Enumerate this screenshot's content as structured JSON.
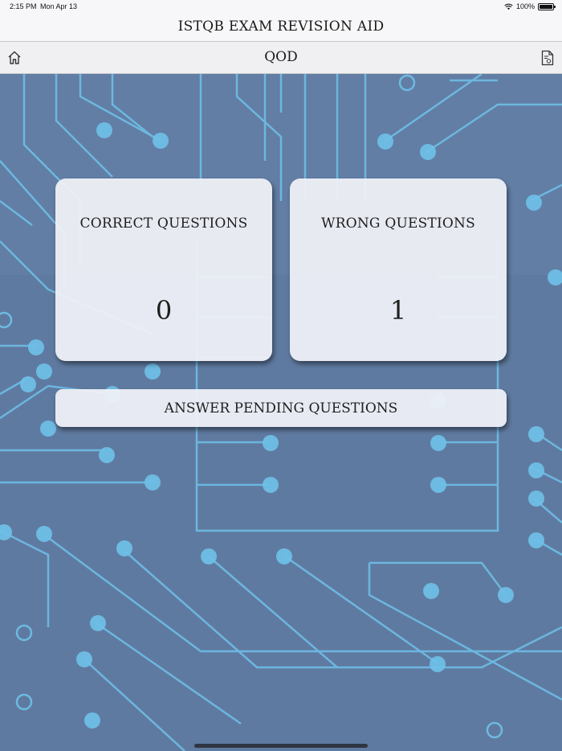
{
  "status_bar": {
    "time": "2:15 PM",
    "date": "Mon Apr 13",
    "battery": "100%"
  },
  "app": {
    "title": "ISTQB EXAM REVISION AID"
  },
  "nav": {
    "title": "QOD",
    "home_icon": "home-icon",
    "document_icon": "document-icon"
  },
  "cards": {
    "correct": {
      "label": "CORRECT QUESTIONS",
      "value": "0"
    },
    "wrong": {
      "label": "WRONG QUESTIONS",
      "value": "1"
    }
  },
  "actions": {
    "pending_label": "ANSWER PENDING QUESTIONS"
  },
  "colors": {
    "background": "#5f7aa0",
    "circuit": "#6fc1ea",
    "card": "#f0f1f6"
  }
}
